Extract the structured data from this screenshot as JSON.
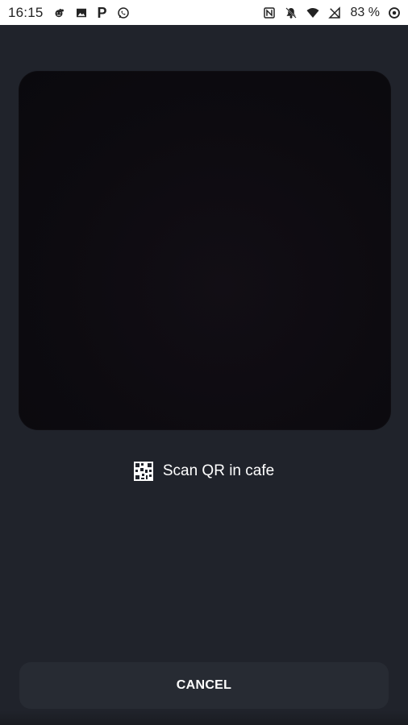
{
  "status_bar": {
    "time": "16:15",
    "battery_percent": "83 %",
    "left_icons": [
      "reddit-icon",
      "image-icon",
      "p-icon",
      "whatsapp-icon"
    ],
    "right_icons": [
      "nfc-icon",
      "notifications-off-icon",
      "wifi-icon",
      "no-signal-icon",
      "battery-saver-icon"
    ]
  },
  "main": {
    "scan_label": "Scan QR in cafe",
    "cancel_label": "CANCEL"
  },
  "colors": {
    "background": "#20232b",
    "preview": "#0d0b10",
    "button": "#272b33",
    "text": "#ffffff",
    "status_bar": "#ffffff"
  }
}
